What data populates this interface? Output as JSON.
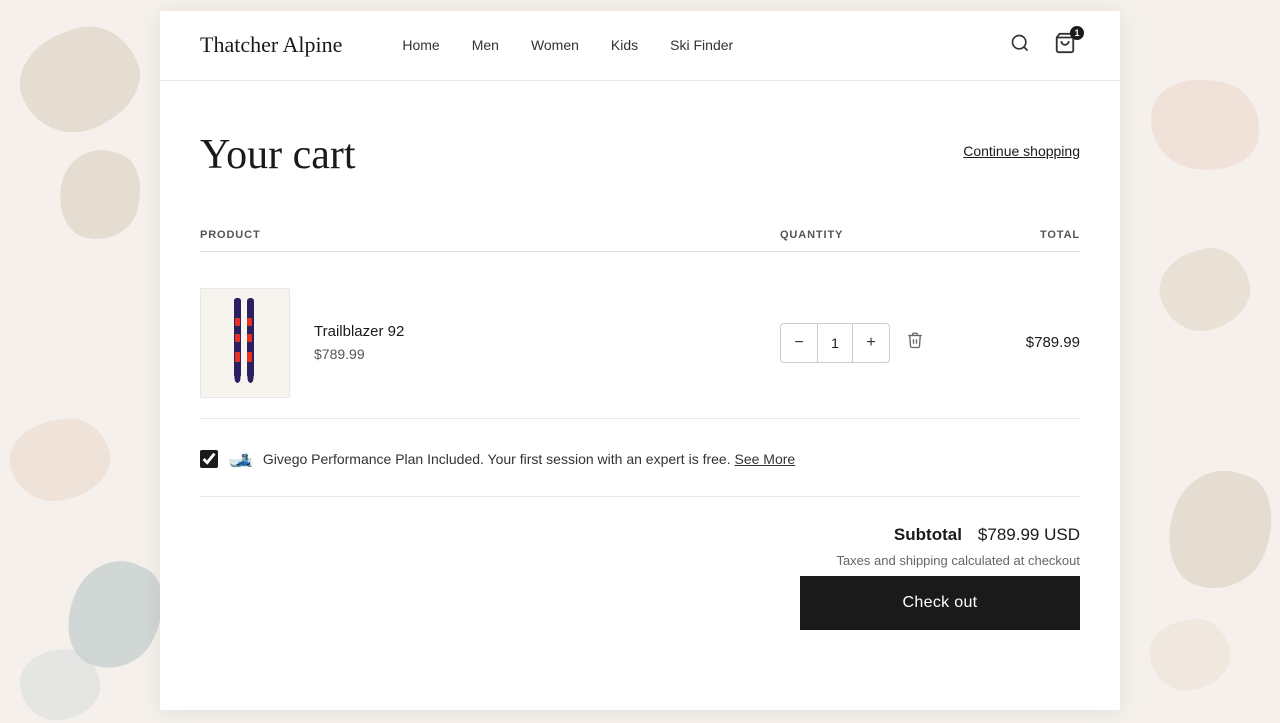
{
  "brand": {
    "name": "Thatcher Alpine"
  },
  "nav": {
    "links": [
      {
        "label": "Home",
        "id": "home"
      },
      {
        "label": "Men",
        "id": "men"
      },
      {
        "label": "Women",
        "id": "women"
      },
      {
        "label": "Kids",
        "id": "kids"
      },
      {
        "label": "Ski Finder",
        "id": "ski-finder"
      }
    ]
  },
  "cart": {
    "title": "Your cart",
    "continue_label": "Continue shopping",
    "columns": {
      "product": "Product",
      "quantity": "Quantity",
      "total": "Total"
    },
    "items": [
      {
        "name": "Trailblazer 92",
        "price": "$789.99",
        "quantity": 1,
        "total": "$789.99"
      }
    ],
    "givego": {
      "text": "Givego Performance Plan Included. Your first session with an expert is free.",
      "link_label": "See More"
    },
    "subtotal_label": "Subtotal",
    "subtotal_value": "$789.99 USD",
    "tax_note": "Taxes and shipping calculated at checkout",
    "checkout_label": "Check out",
    "cart_count": "1"
  }
}
